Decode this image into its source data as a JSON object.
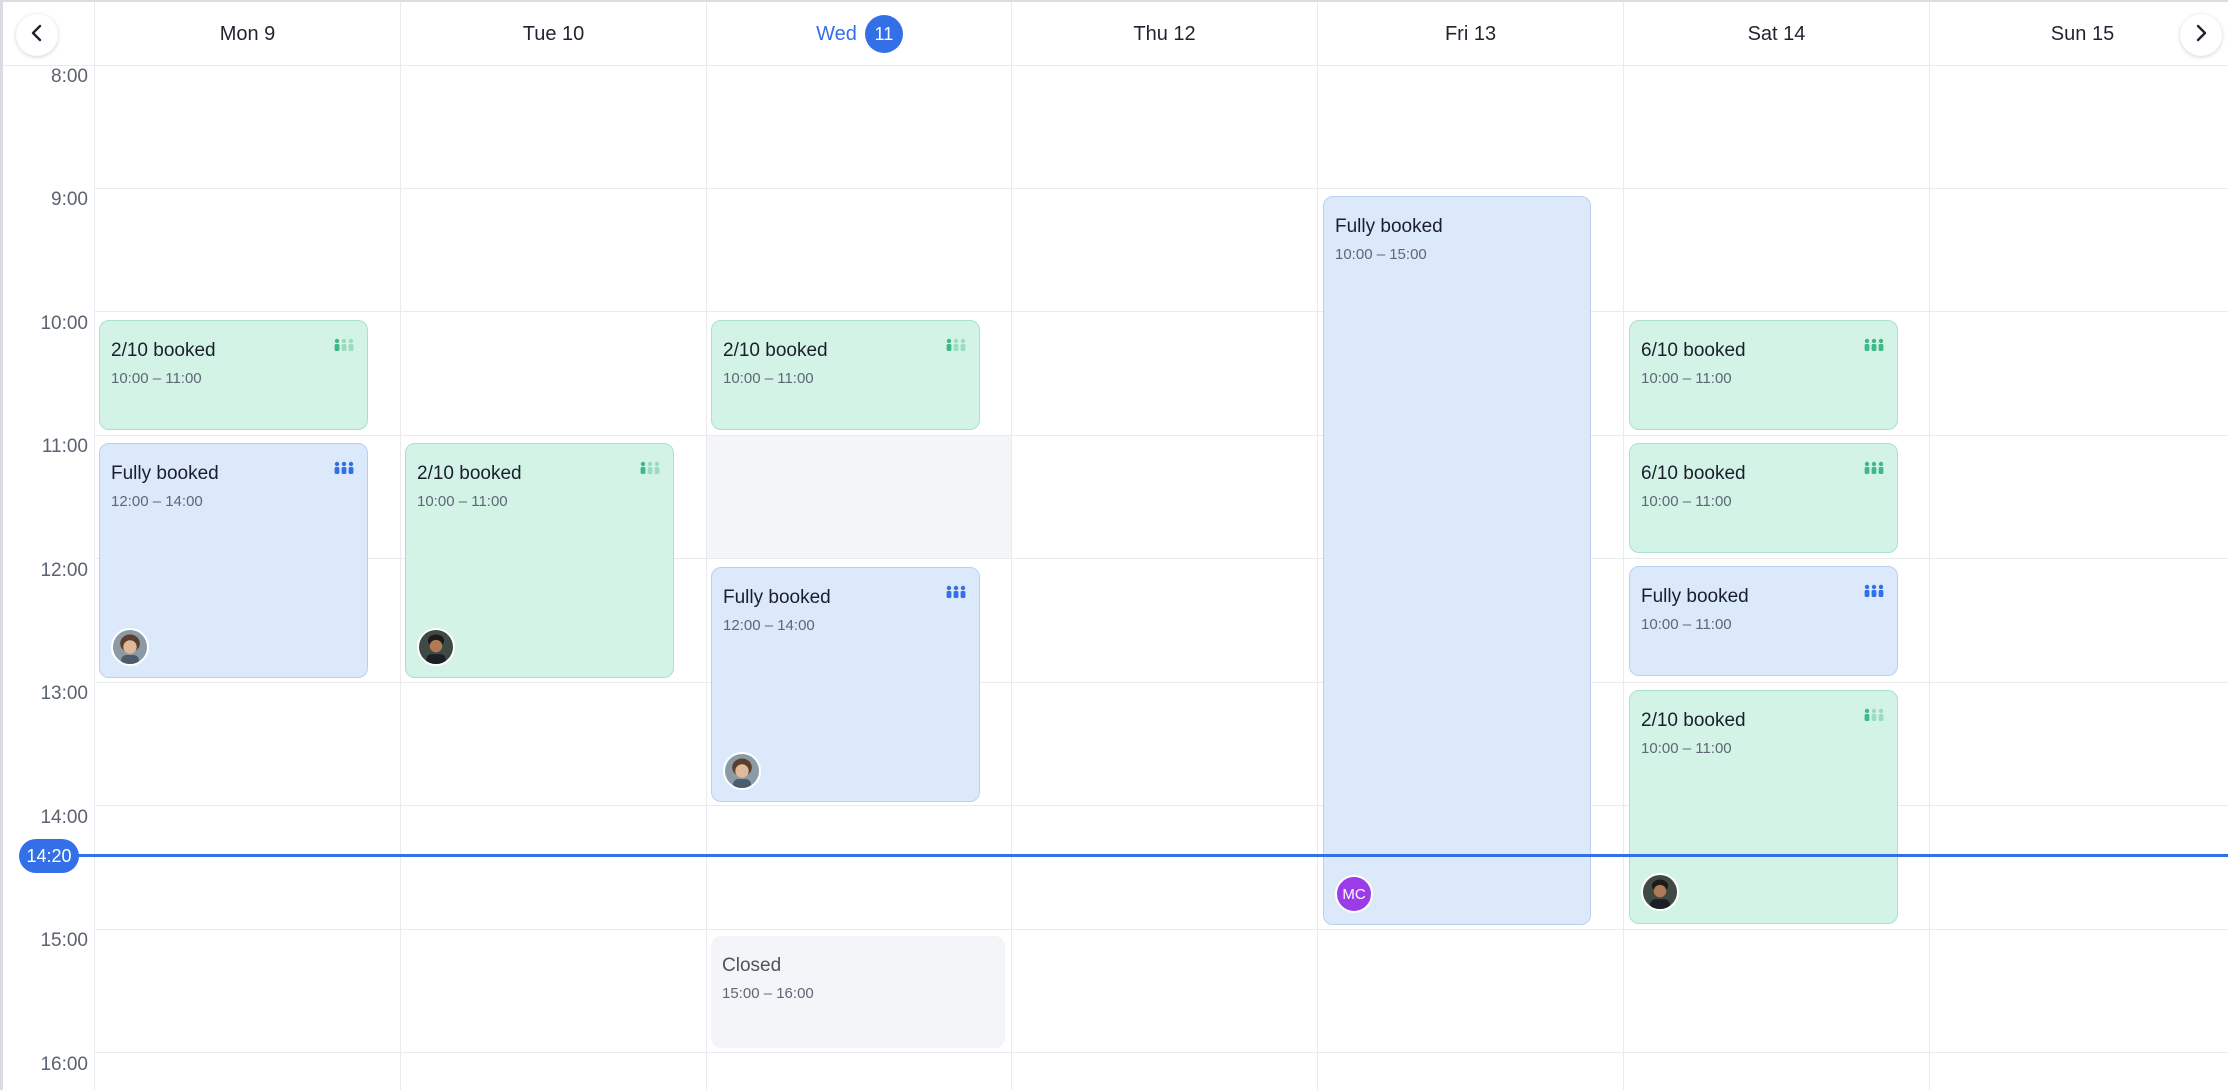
{
  "nav": {
    "prev_icon": "chevron-left-icon",
    "next_icon": "chevron-right-icon"
  },
  "days": [
    {
      "label": "Mon 9"
    },
    {
      "label": "Tue 10"
    },
    {
      "label": "Wed",
      "badge": "11",
      "today": true
    },
    {
      "label": "Thu 12"
    },
    {
      "label": "Fri 13"
    },
    {
      "label": "Sat 14"
    },
    {
      "label": "Sun 15"
    }
  ],
  "hours": [
    "8:00",
    "9:00",
    "10:00",
    "11:00",
    "12:00",
    "13:00",
    "14:00",
    "15:00",
    "16:00"
  ],
  "now": {
    "label": "14:20"
  },
  "colors": {
    "accent": "#3370e8",
    "green_event": "#d3f3e7",
    "blue_event": "#dce9fb",
    "closed": "#f4f5f8",
    "avatar_mc": "#9b3ce8"
  },
  "events": [
    {
      "id": "mon-1",
      "title": "2/10 booked",
      "time": "10:00 – 11:00",
      "status": "partial"
    },
    {
      "id": "mon-2",
      "title": "Fully booked",
      "time": "12:00 – 14:00",
      "status": "full",
      "avatar": "person-photo-1"
    },
    {
      "id": "tue-1",
      "title": "2/10 booked",
      "time": "10:00 – 11:00",
      "status": "partial",
      "avatar": "person-photo-2"
    },
    {
      "id": "wed-1",
      "title": "2/10 booked",
      "time": "10:00 – 11:00",
      "status": "partial"
    },
    {
      "id": "wed-2",
      "title": "Fully booked",
      "time": "12:00 – 14:00",
      "status": "full",
      "avatar": "person-photo-1"
    },
    {
      "id": "wed-3",
      "title": "Closed",
      "time": "15:00 – 16:00",
      "status": "closed"
    },
    {
      "id": "fri-1",
      "title": "Fully booked",
      "time": "10:00 – 15:00",
      "status": "full",
      "avatar_initials": "MC"
    },
    {
      "id": "sat-1",
      "title": "6/10 booked",
      "time": "10:00 – 11:00",
      "status": "partial"
    },
    {
      "id": "sat-2",
      "title": "6/10 booked",
      "time": "10:00 – 11:00",
      "status": "partial"
    },
    {
      "id": "sat-3",
      "title": "Fully booked",
      "time": "10:00 – 11:00",
      "status": "full"
    },
    {
      "id": "sat-4",
      "title": "2/10 booked",
      "time": "10:00 – 11:00",
      "status": "partial",
      "avatar": "person-photo-2"
    }
  ]
}
